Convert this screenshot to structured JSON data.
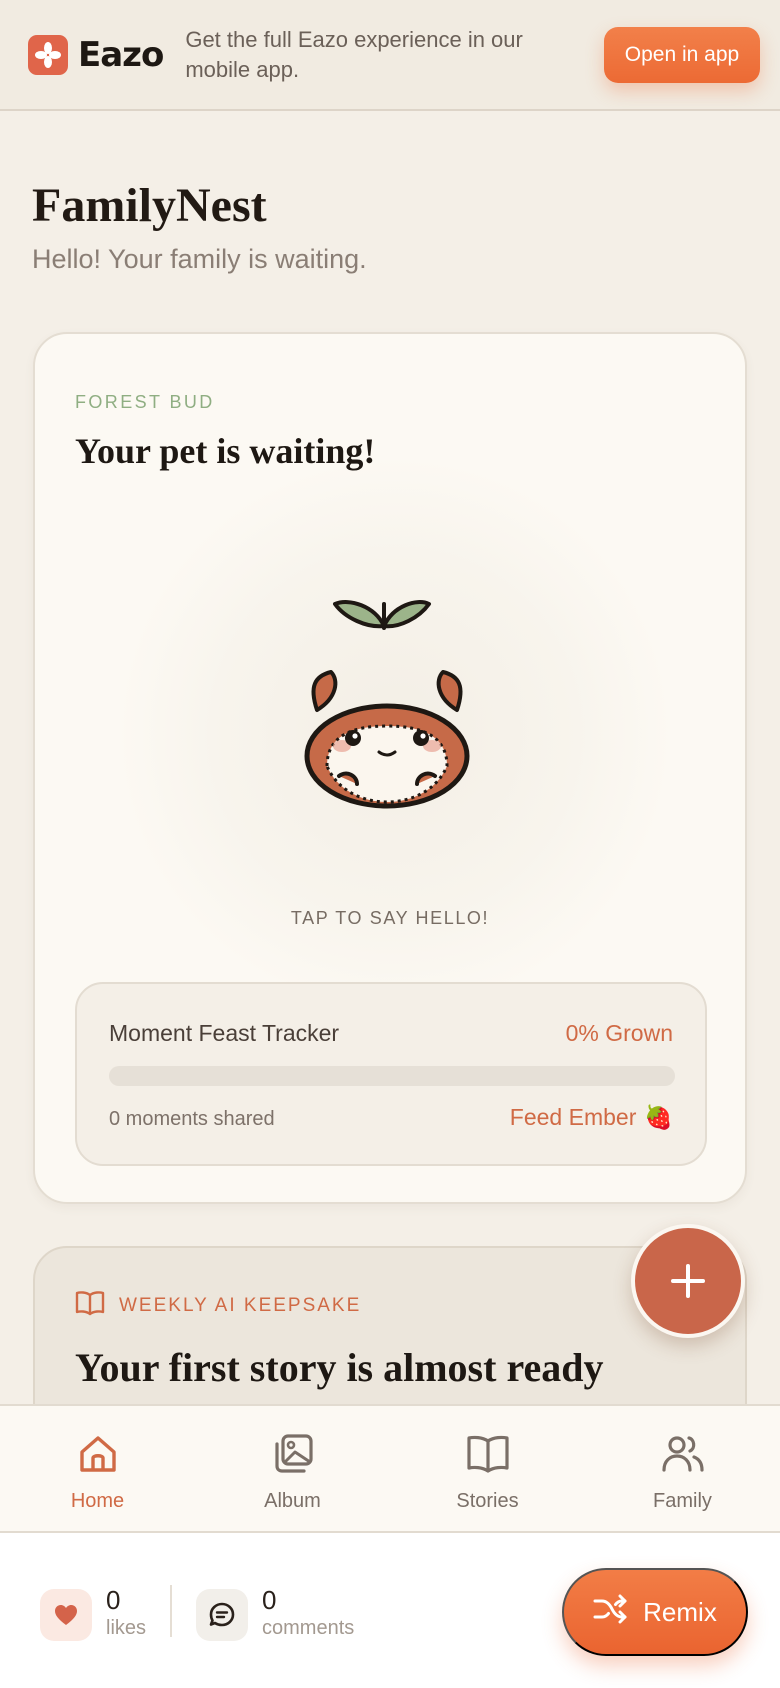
{
  "banner": {
    "brand": "Eazo",
    "message": "Get the full Eazo experience in our mobile app.",
    "open_label": "Open in app"
  },
  "page": {
    "title": "FamilyNest",
    "subtitle": "Hello! Your family is waiting."
  },
  "pet_card": {
    "eyebrow": "FOREST BUD",
    "heading": "Your pet is waiting!",
    "tap_hint": "TAP TO SAY HELLO!",
    "tracker": {
      "title": "Moment Feast Tracker",
      "percent_label": "0% Grown",
      "progress": 0,
      "count": "0 moments shared",
      "feed_label": "Feed Ember",
      "feed_emoji": "🍓"
    }
  },
  "keepsake_card": {
    "eyebrow": "WEEKLY AI KEEPSAKE",
    "heading": "Your first story is almost ready"
  },
  "nav": {
    "items": [
      {
        "label": "Home",
        "icon": "home-icon",
        "active": true
      },
      {
        "label": "Album",
        "icon": "album-icon",
        "active": false
      },
      {
        "label": "Stories",
        "icon": "book-icon",
        "active": false
      },
      {
        "label": "Family",
        "icon": "people-icon",
        "active": false
      }
    ]
  },
  "social": {
    "likes_count": "0",
    "likes_label": "likes",
    "comments_count": "0",
    "comments_label": "comments",
    "remix_label": "Remix"
  },
  "colors": {
    "accent": "#d06a45",
    "cta": "#ec6a34",
    "background": "#f4efe7",
    "green": "#8fae82"
  }
}
